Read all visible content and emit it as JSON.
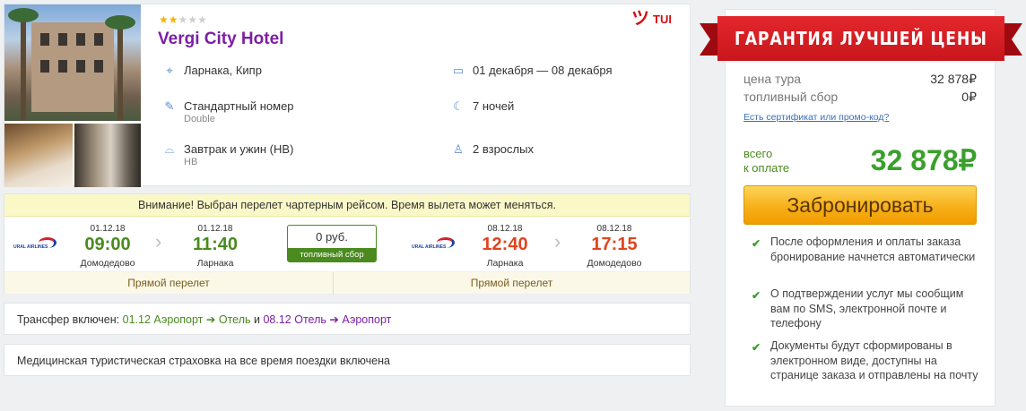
{
  "hotel": {
    "stars_filled": 2,
    "stars_total": 5,
    "name": "Vergi City Hotel",
    "operator": "TUI",
    "location": "Ларнака, Кипр",
    "dates": "01 декабря — 08 декабря",
    "room": "Стандартный номер",
    "room_type": "Double",
    "nights": "7 ночей",
    "meal": "Завтрак и ужин (HB)",
    "meal_code": "HB",
    "guests": "2 взрослых"
  },
  "flight": {
    "warning": "Внимание! Выбран перелет чартерным рейсом. Время вылета может меняться.",
    "airline_logo_text": "URAL AIRLINES",
    "outbound": {
      "dep_date": "01.12.18",
      "dep_time": "09:00",
      "dep_place": "Домодедово",
      "arr_date": "01.12.18",
      "arr_time": "11:40",
      "arr_place": "Ларнака",
      "type": "Прямой перелет"
    },
    "return": {
      "dep_date": "08.12.18",
      "dep_time": "12:40",
      "dep_place": "Ларнака",
      "arr_date": "08.12.18",
      "arr_time": "17:15",
      "arr_place": "Домодедово",
      "type": "Прямой перелет"
    },
    "fuel_price": "0 руб.",
    "fuel_label": "топливный сбор"
  },
  "transfer": {
    "prefix": "Трансфер включен:",
    "leg1": "01.12 Аэропорт",
    "arrow1": "➔",
    "leg1_to": "Отель",
    "and": "и",
    "leg2": "08.12 Отель",
    "arrow2": "➔",
    "leg2_to": "Аэропорт"
  },
  "insurance": "Медицинская туристическая страховка на все время поездки включена",
  "pricing": {
    "banner": "ГАРАНТИЯ ЛУЧШЕЙ ЦЕНЫ",
    "tour_price_label": "цена тура",
    "tour_price": "32 878₽",
    "fuel_label": "топливный сбор",
    "fuel_value": "0₽",
    "promo_link": "Есть сертификат или промо-код?",
    "total_label_1": "всего",
    "total_label_2": "к оплате",
    "total": "32 878₽",
    "book_button": "Забронировать",
    "notes": [
      "После оформления и оплаты заказа бронирование начнется автоматически",
      "О подтверждении услуг мы сообщим вам по SMS, электронной почте и телефону",
      "Документы будут сформированы в электронном виде, доступны на странице заказа и отправлены на почту"
    ]
  },
  "colors": {
    "hotel_name": "#7b1fa2",
    "accent_green": "#4a8a1e",
    "accent_red": "#e0451d",
    "banner_red": "#d32027",
    "button_orange": "#f7b019"
  }
}
